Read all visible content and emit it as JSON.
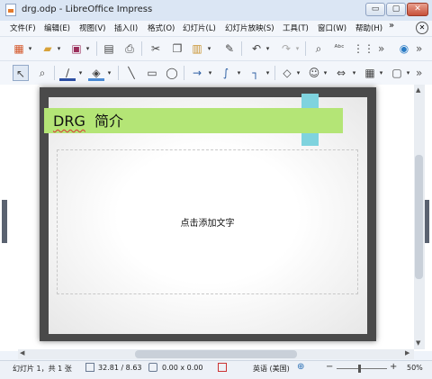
{
  "window": {
    "title": "drg.odp - LibreOffice Impress",
    "min": "▭",
    "max": "▢",
    "close": "✕"
  },
  "menu": [
    "文件(F)",
    "编辑(E)",
    "视图(V)",
    "插入(I)",
    "格式(O)",
    "幻灯片(L)",
    "幻灯片放映(S)",
    "工具(T)",
    "窗口(W)",
    "帮助(H)"
  ],
  "slide": {
    "title": "DRG  简介",
    "title_underlined": "DRG",
    "title_rest": "  简介",
    "content_placeholder": "点击添加文字"
  },
  "status": {
    "slide": "幻灯片 1，共 1 张",
    "position": "32.81 / 8.63",
    "size": "0.00 x 0.00",
    "language": "英语 (美国)",
    "zoom": "50%",
    "zoom_level": 0.5
  },
  "colors": {
    "title_band": "#b4e576",
    "accent_block": "#7fd3de",
    "slide_frame": "#4a4a4a"
  }
}
